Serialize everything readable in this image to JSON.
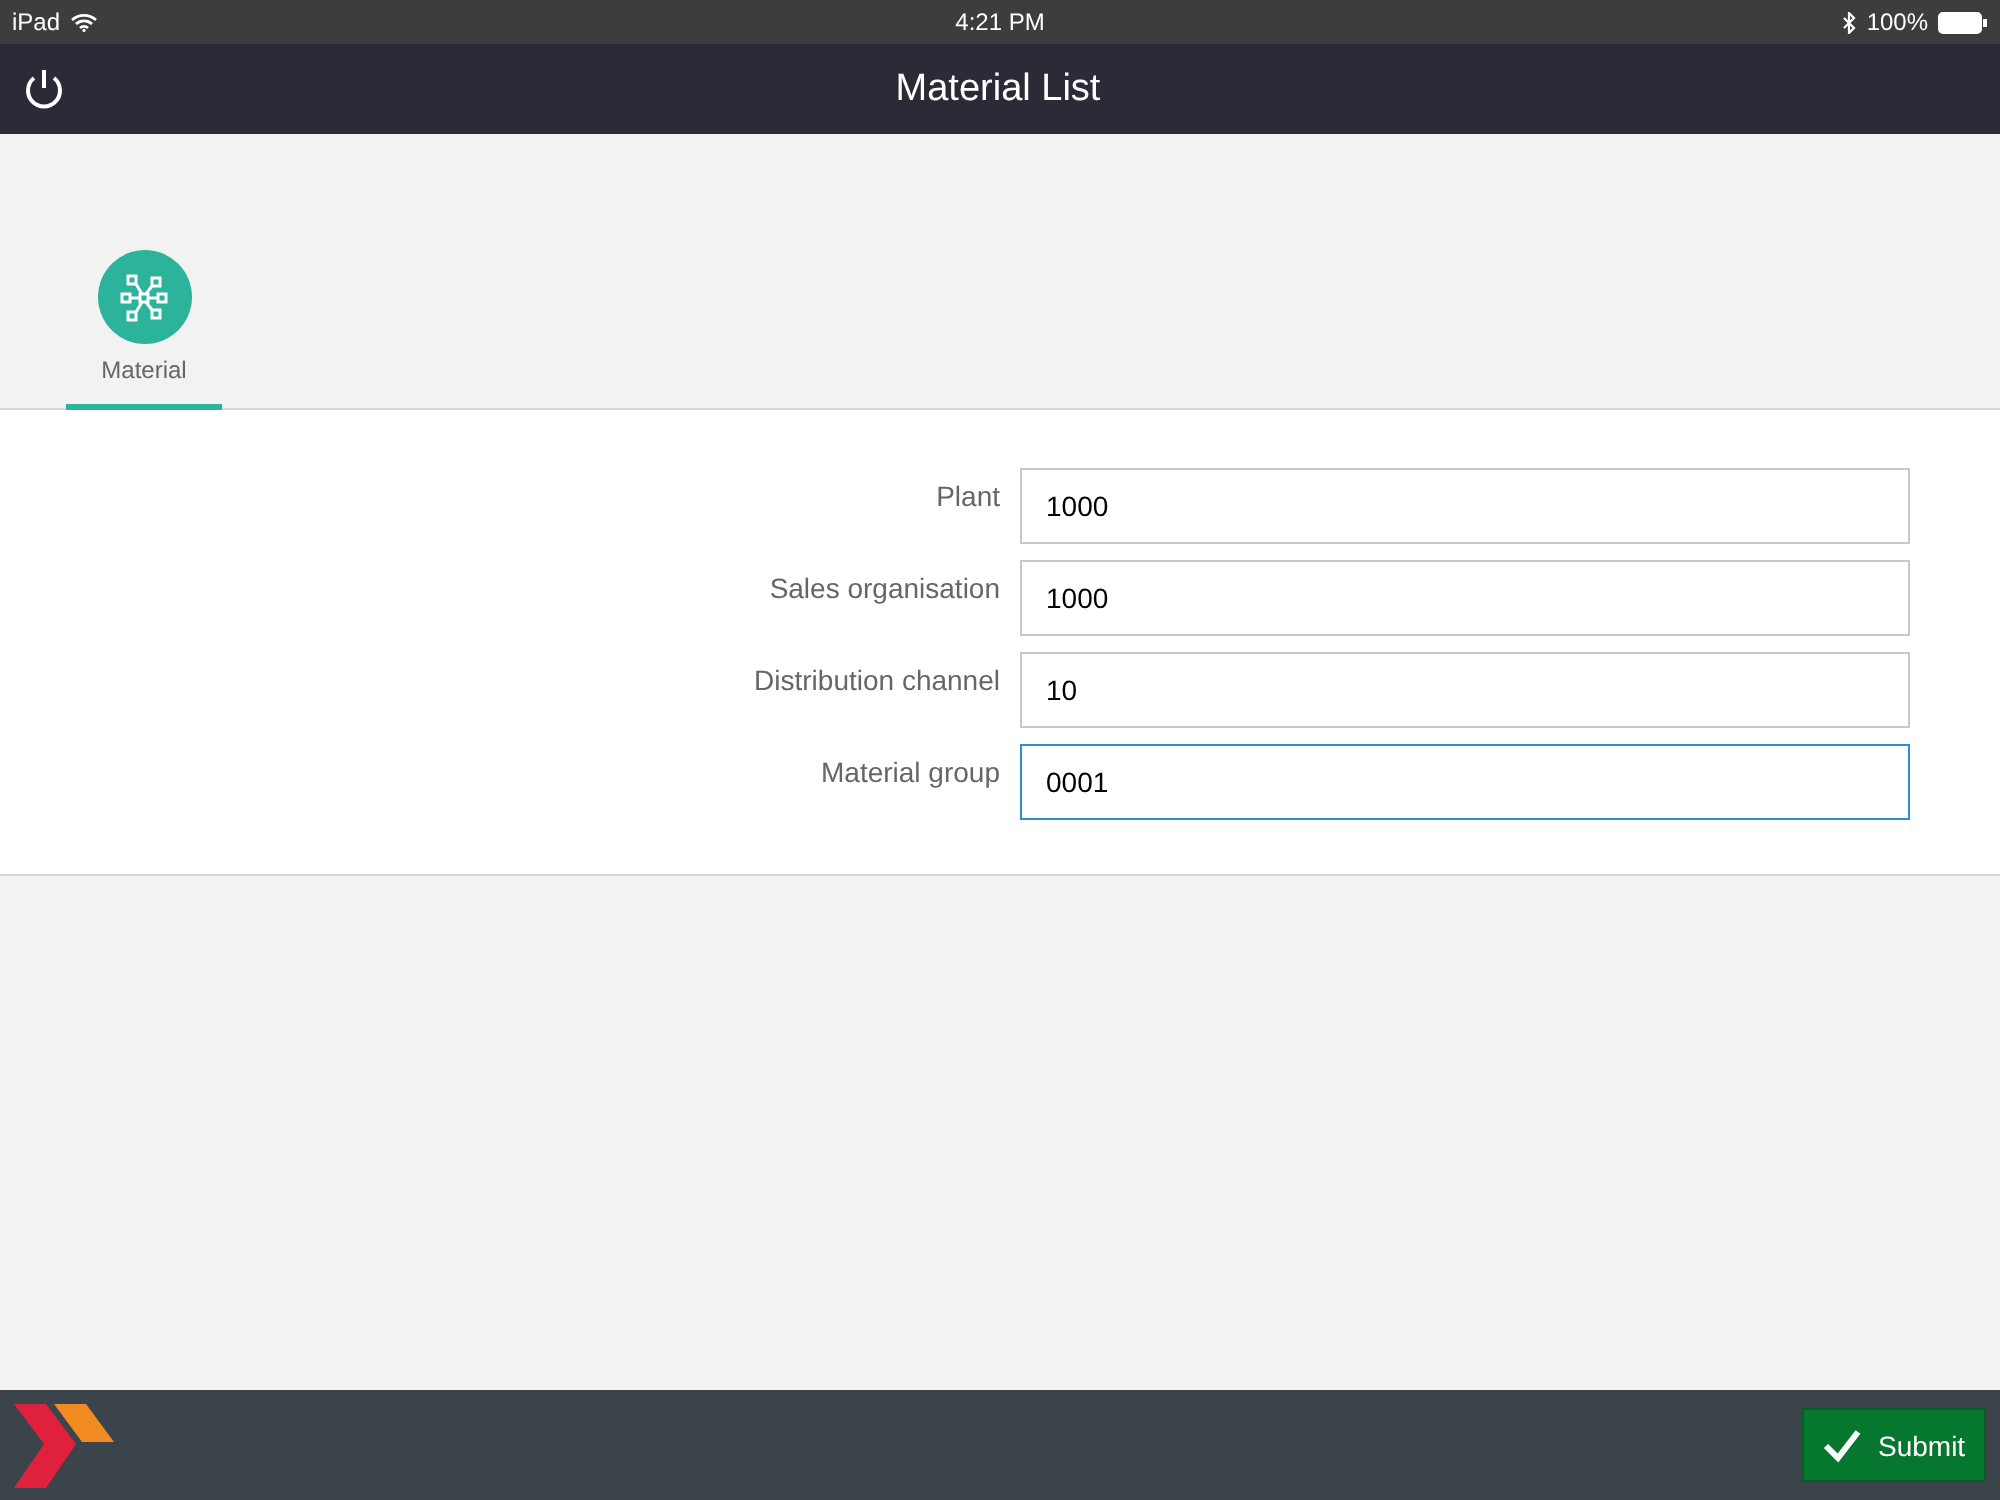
{
  "status_bar": {
    "device": "iPad",
    "time": "4:21 PM",
    "battery": "100%"
  },
  "header": {
    "title": "Material List"
  },
  "tabs": [
    {
      "label": "Material",
      "selected": true
    }
  ],
  "form": {
    "fields": [
      {
        "label": "Plant",
        "value": "1000",
        "focused": false
      },
      {
        "label": "Sales organisation",
        "value": "1000",
        "focused": false
      },
      {
        "label": "Distribution channel",
        "value": "10",
        "focused": false
      },
      {
        "label": "Material group",
        "value": "0001",
        "focused": true
      }
    ]
  },
  "footer": {
    "submit": "Submit"
  }
}
